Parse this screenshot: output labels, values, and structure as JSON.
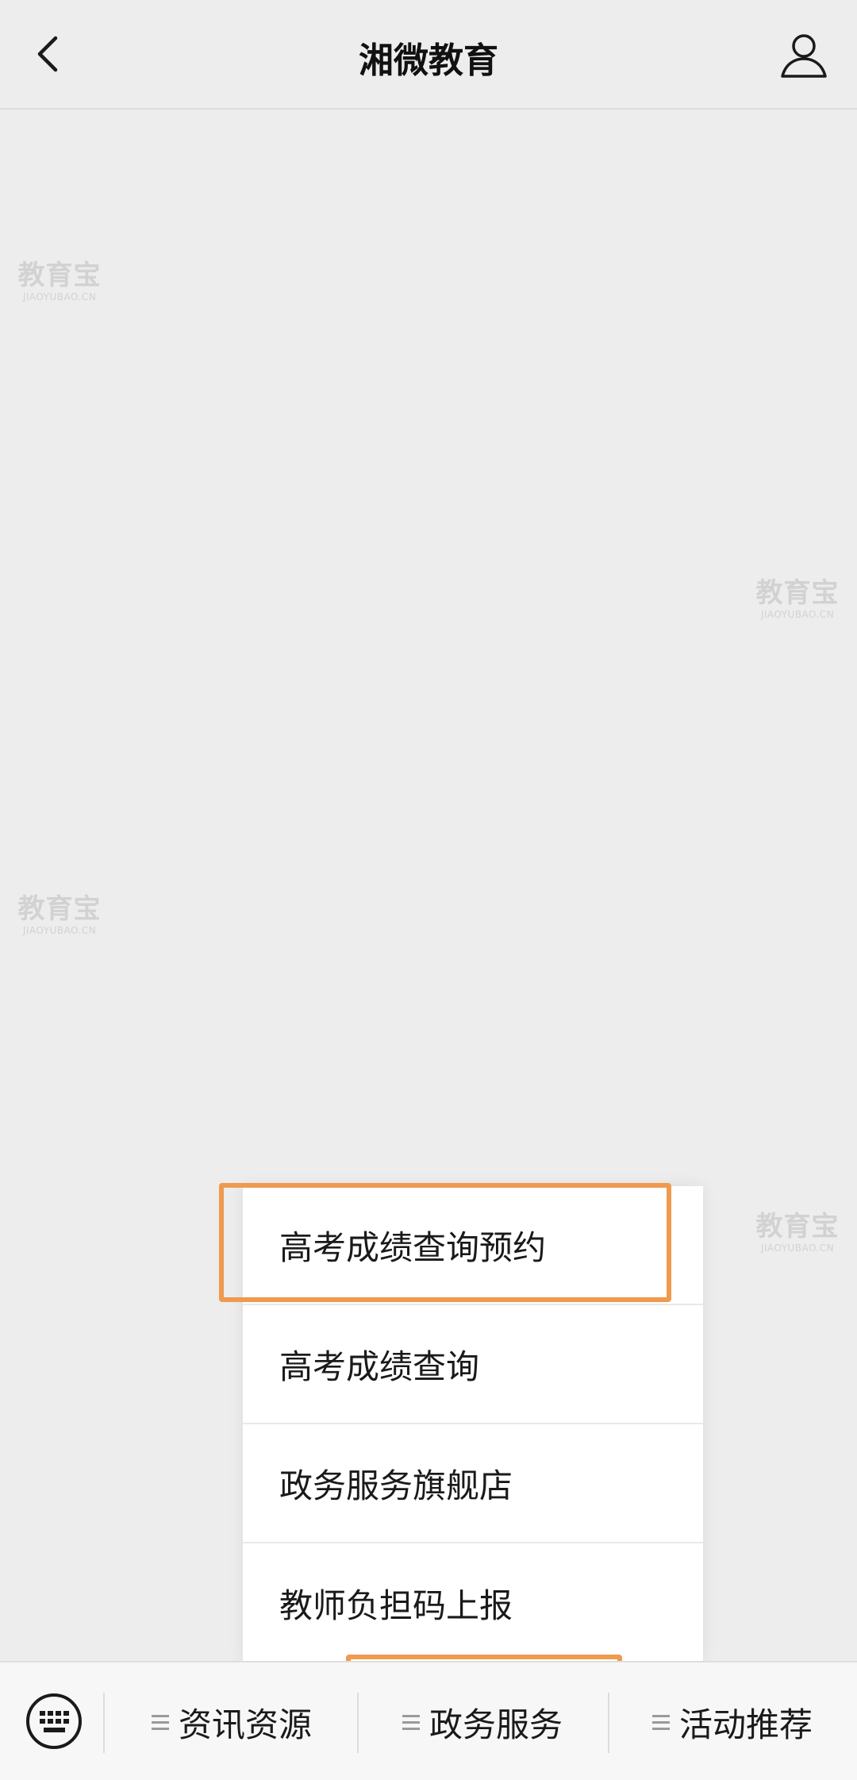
{
  "nav": {
    "title": "湘微教育",
    "back_icon": "chevron-left-icon",
    "profile_icon": "person-outline-icon"
  },
  "watermark": {
    "logo": "教育宝",
    "url": "JIAOYUBAO.CN"
  },
  "submenu": {
    "items": [
      {
        "label": "高考成绩查询预约"
      },
      {
        "label": "高考成绩查询"
      },
      {
        "label": "政务服务旗舰店"
      },
      {
        "label": "教师负担码上报"
      }
    ]
  },
  "bottom_menu": {
    "keyboard_icon": "keyboard-icon",
    "tabs": [
      {
        "label": "资讯资源"
      },
      {
        "label": "政务服务"
      },
      {
        "label": "活动推荐"
      }
    ]
  },
  "colors": {
    "highlight": "#ef9a4f",
    "background": "#ededed",
    "menu_bg": "#ffffff"
  }
}
